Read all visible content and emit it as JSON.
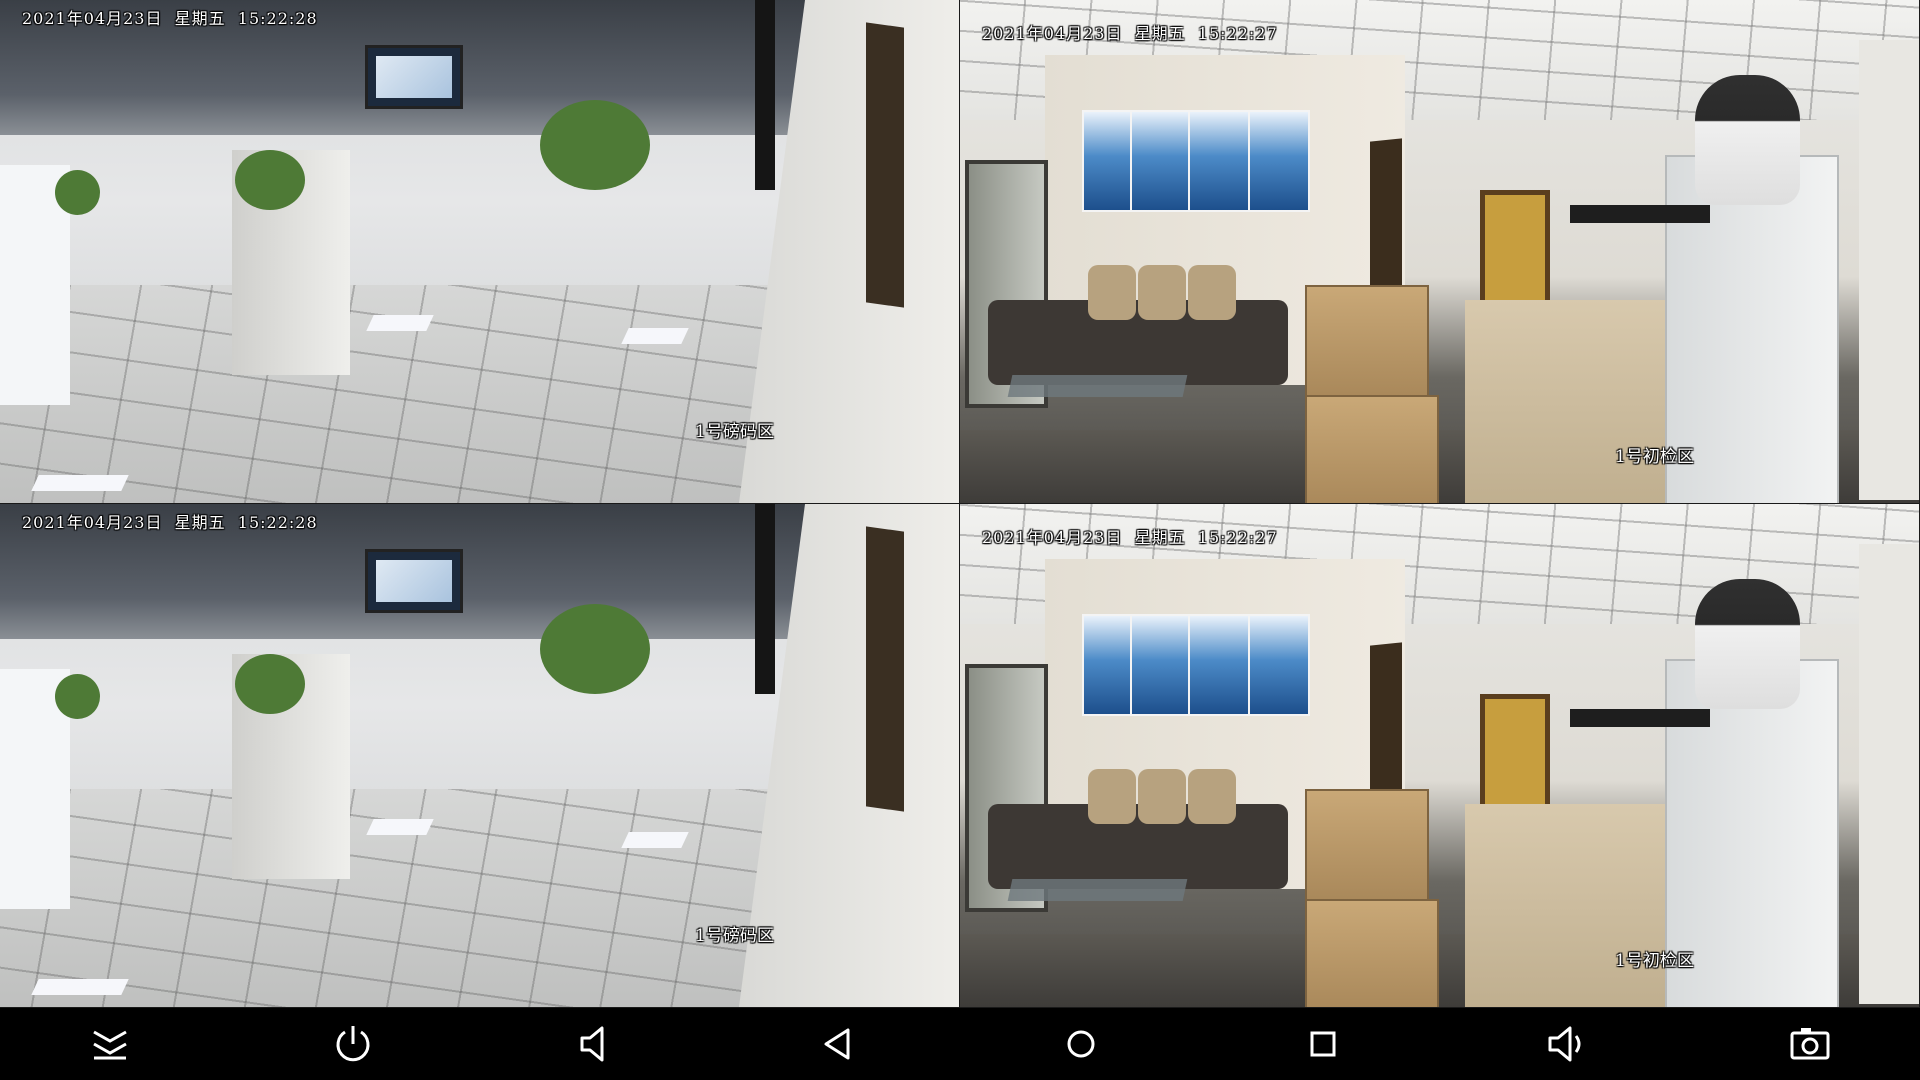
{
  "feeds": [
    {
      "timestamp": "2021年04月23日  星期五  15:22:28",
      "zone_label": "1号磅码区"
    },
    {
      "timestamp": "2021年04月23日  星期五  15:22:27",
      "zone_label": "1号初检区"
    },
    {
      "timestamp": "2021年04月23日  星期五  15:22:28",
      "zone_label": "1号磅码区"
    },
    {
      "timestamp": "2021年04月23日  星期五  15:22:27",
      "zone_label": "1号初检区"
    }
  ],
  "navbar": {
    "buttons": [
      {
        "icon": "collapse-chevron-icon"
      },
      {
        "icon": "power-icon"
      },
      {
        "icon": "volume-down-icon"
      },
      {
        "icon": "back-triangle-icon"
      },
      {
        "icon": "home-circle-icon"
      },
      {
        "icon": "recents-square-icon"
      },
      {
        "icon": "volume-up-icon"
      },
      {
        "icon": "screenshot-camera-icon"
      }
    ],
    "icon_color": "#ffffff",
    "background": "#000000"
  }
}
